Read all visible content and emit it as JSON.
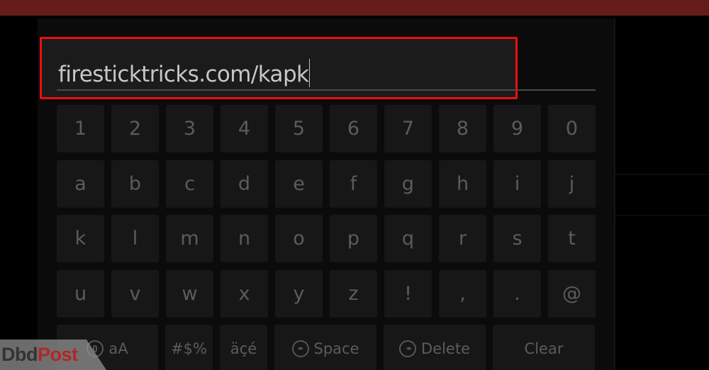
{
  "colors": {
    "top_bar": "#661d19",
    "highlight_outline": "#e8100f",
    "key_background": "#171717",
    "key_text": "#5c5c5c",
    "input_text": "#c7c7c7",
    "watermark_dark": "#333333",
    "watermark_accent": "#b2262a"
  },
  "search": {
    "value": "firesticktricks.com/kapk",
    "highlighted": true
  },
  "keyboard": {
    "rows": [
      [
        "1",
        "2",
        "3",
        "4",
        "5",
        "6",
        "7",
        "8",
        "9",
        "0"
      ],
      [
        "a",
        "b",
        "c",
        "d",
        "e",
        "f",
        "g",
        "h",
        "i",
        "j"
      ],
      [
        "k",
        "l",
        "m",
        "n",
        "o",
        "p",
        "q",
        "r",
        "s",
        "t"
      ],
      [
        "u",
        "v",
        "w",
        "x",
        "y",
        "z",
        "!",
        ",",
        ".",
        "@"
      ]
    ],
    "bottom_row": {
      "case_toggle": {
        "label": "aA",
        "icon": "voice-icon"
      },
      "symbols": {
        "label": "#$%"
      },
      "accents": {
        "label": "äçé"
      },
      "space": {
        "label": "Space",
        "icon": "fast-forward-icon"
      },
      "delete": {
        "label": "Delete",
        "icon": "rewind-icon"
      },
      "clear": {
        "label": "Clear"
      }
    }
  },
  "watermark": {
    "part1": "Dbd",
    "part2": "Post"
  }
}
